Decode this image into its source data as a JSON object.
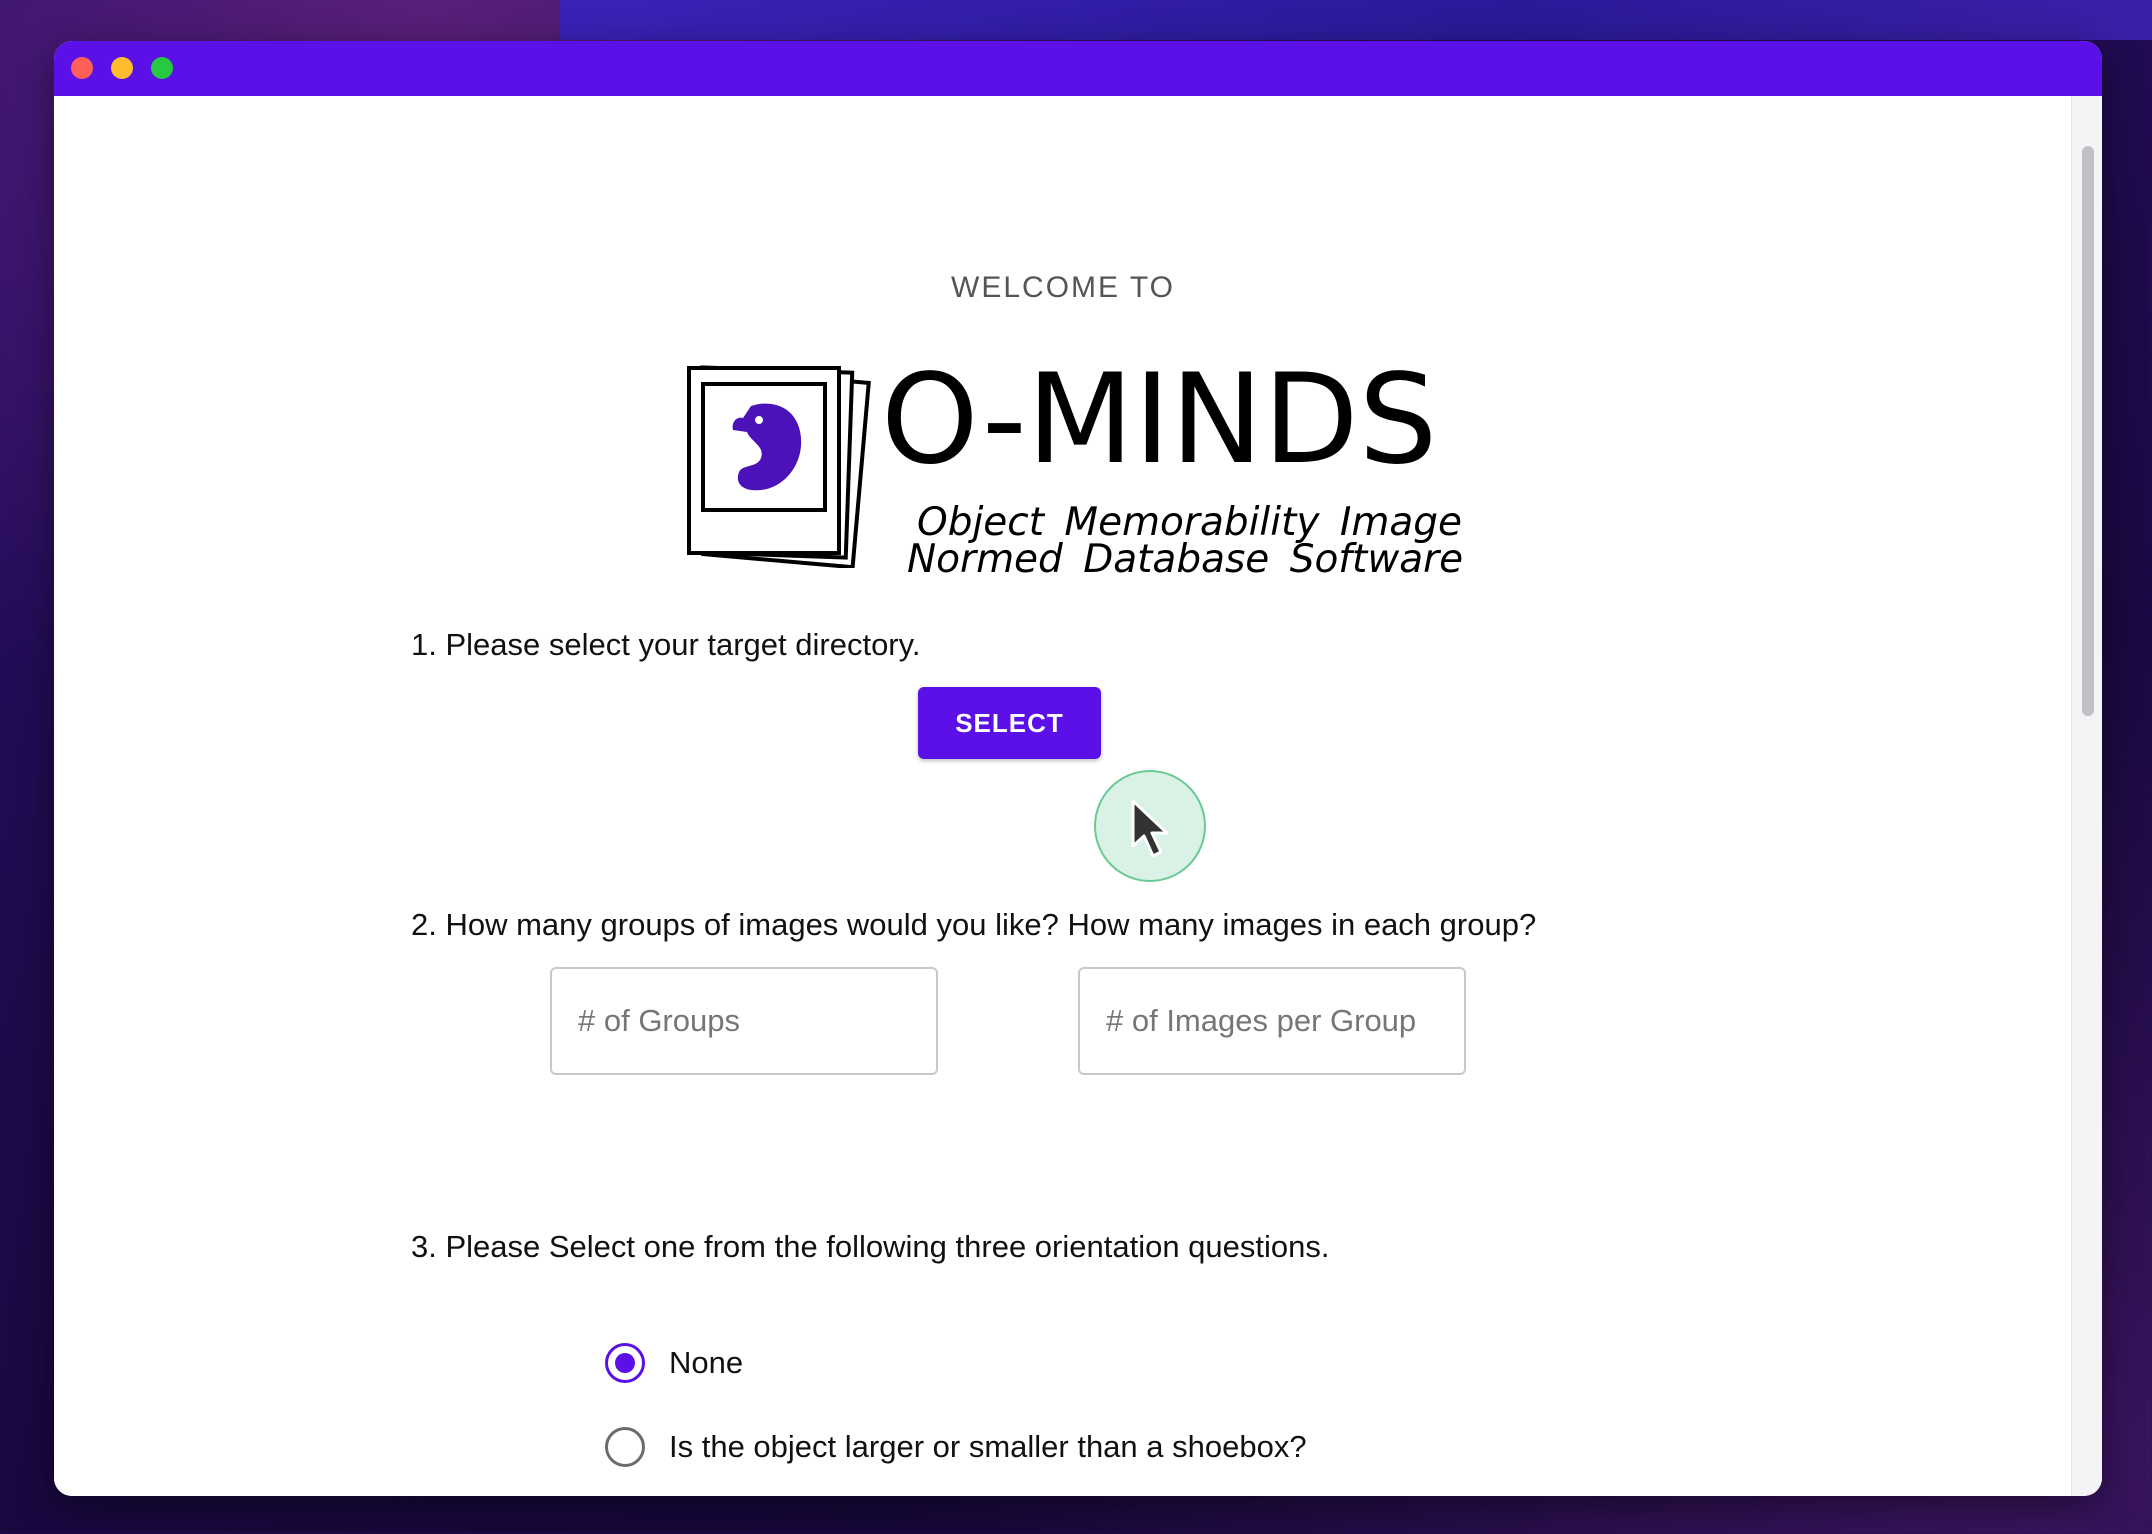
{
  "window": {
    "controls": [
      "close",
      "minimize",
      "maximize"
    ],
    "accent_color": "#5a10e6"
  },
  "header": {
    "welcome": "WELCOME TO"
  },
  "logo": {
    "title": "O-MINDS",
    "subtitle_line1": "Object Memorability Image",
    "subtitle_line2": "Normed Database Software",
    "icon": "seahorse-photo-stack-icon"
  },
  "steps": {
    "step1": {
      "question": "1. Please select your target directory.",
      "button_label": "SELECT"
    },
    "step2": {
      "question": "2. How many groups of images would you like? How many images in each group?",
      "groups_placeholder": "# of Groups",
      "images_placeholder": "# of Images per Group"
    },
    "step3": {
      "question": "3. Please Select one from the following three orientation questions.",
      "options": [
        {
          "label": "None",
          "selected": true
        },
        {
          "label": "Is the object larger or smaller than a shoebox?",
          "selected": false
        }
      ]
    }
  }
}
